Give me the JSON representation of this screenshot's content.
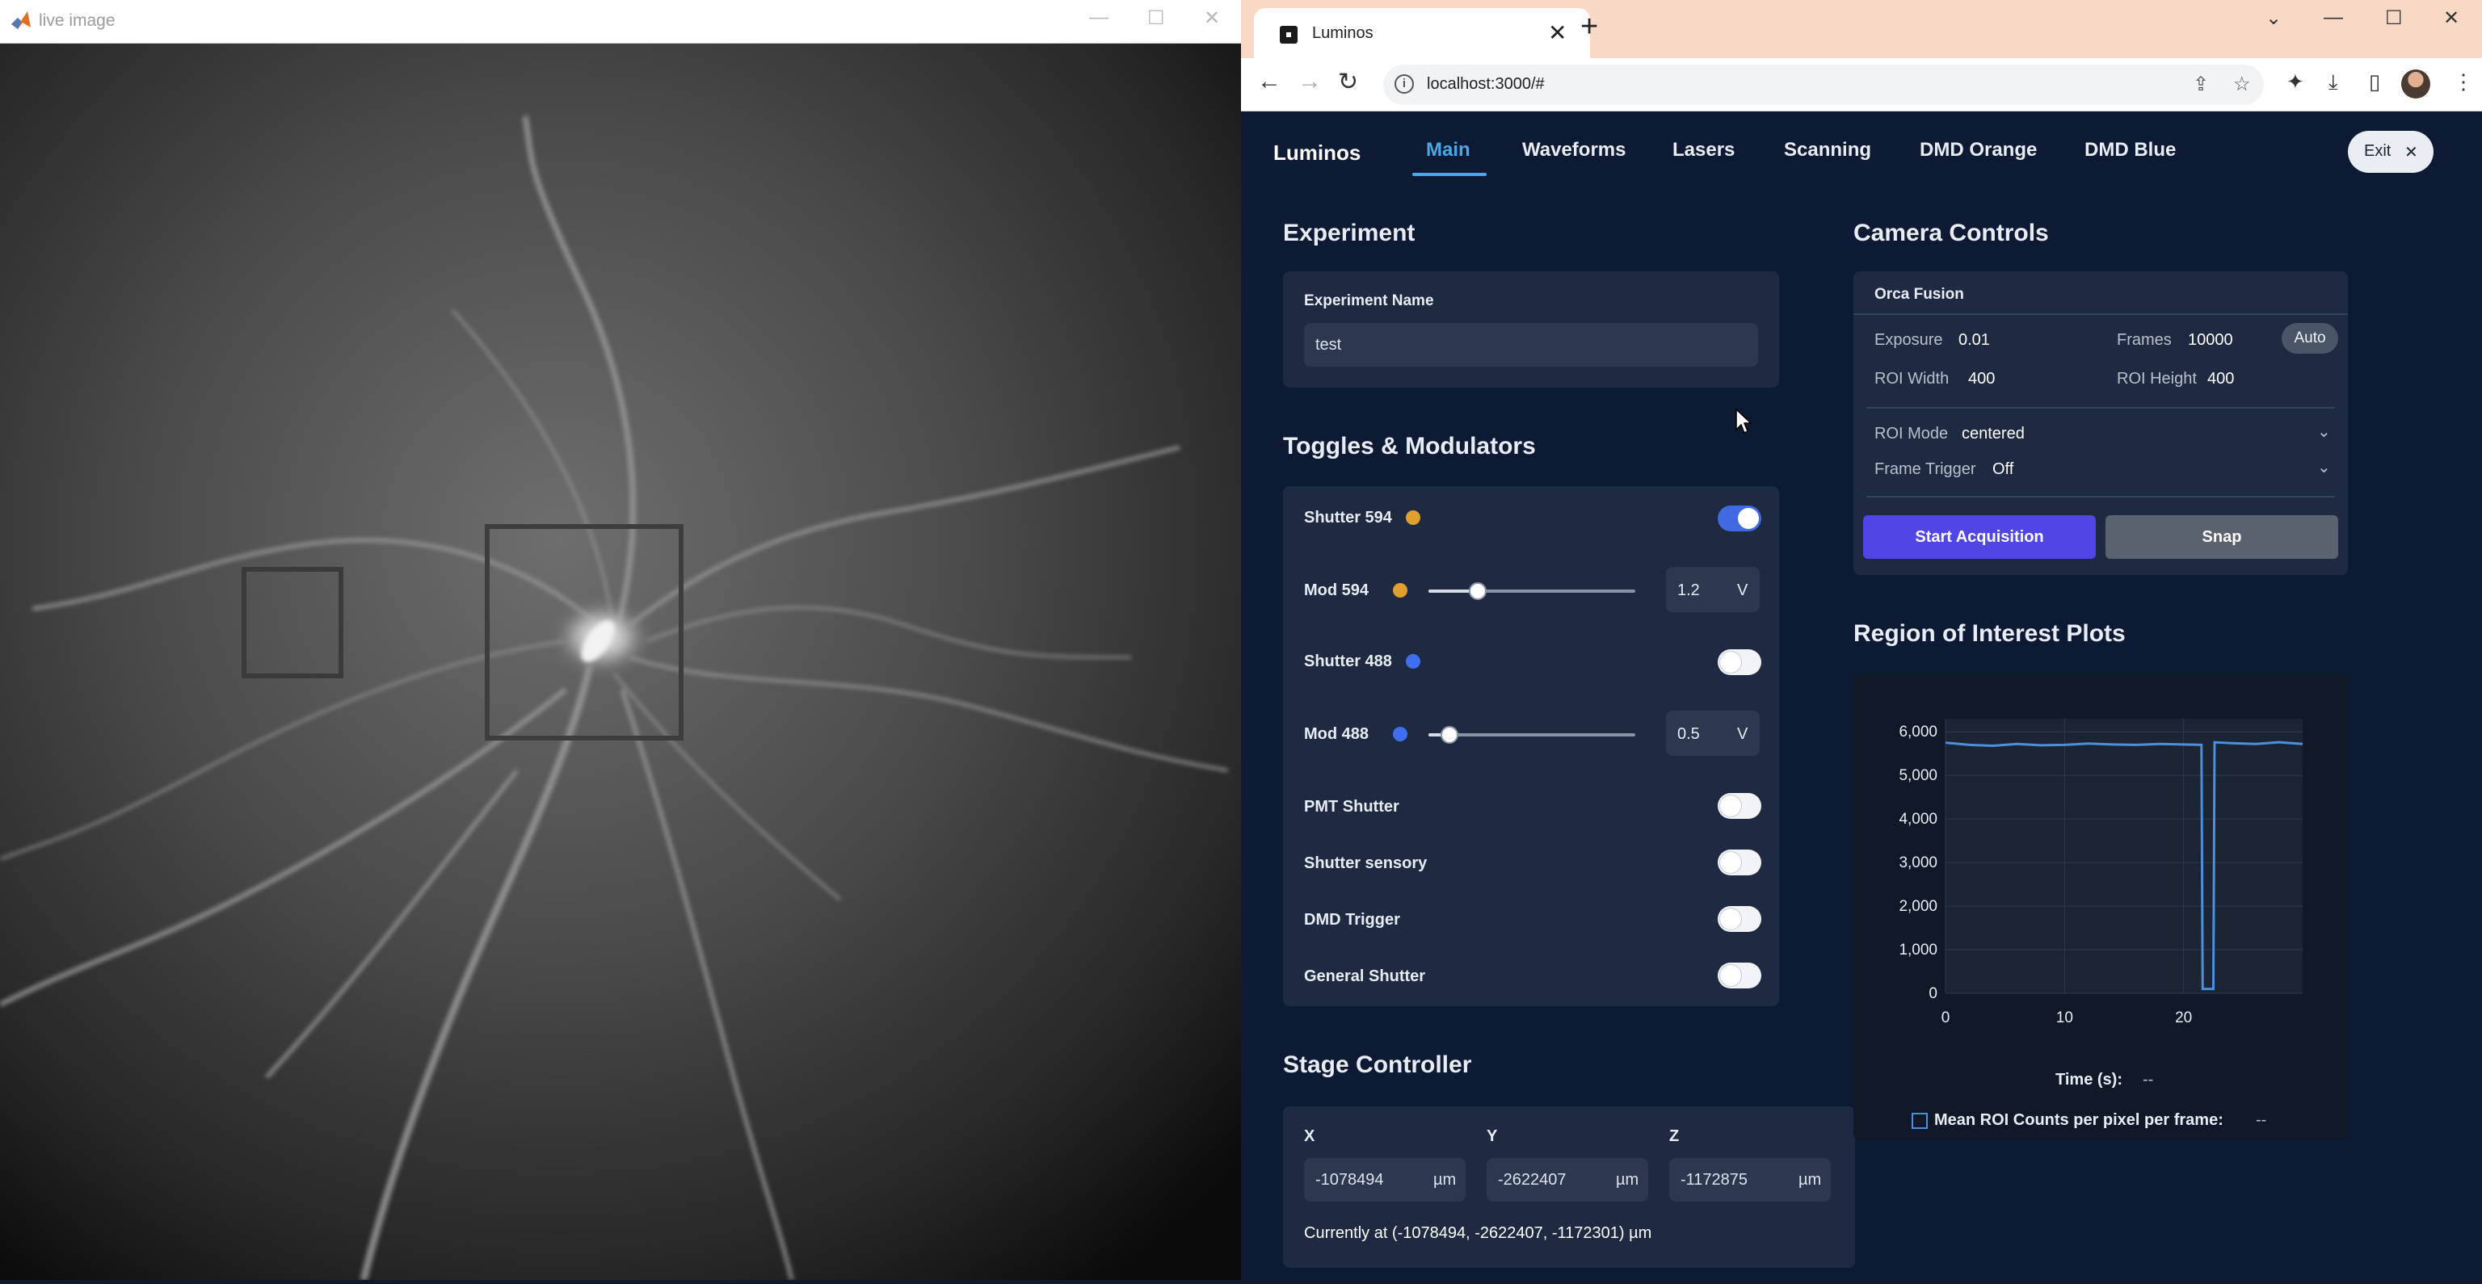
{
  "live_window": {
    "title": "live image",
    "controls": {
      "minimize": "—",
      "maximize": "☐",
      "close": "✕"
    }
  },
  "browser": {
    "tab_title": "Luminos",
    "tab_close": "✕",
    "new_tab": "+",
    "url": "localhost:3000/#",
    "window_controls": {
      "chevron": "⌄",
      "minimize": "—",
      "maximize": "☐",
      "close": "✕"
    }
  },
  "app": {
    "brand": "Luminos",
    "tabs": [
      {
        "label": "Main",
        "active": true
      },
      {
        "label": "Waveforms",
        "active": false
      },
      {
        "label": "Lasers",
        "active": false
      },
      {
        "label": "Scanning",
        "active": false
      },
      {
        "label": "DMD Orange",
        "active": false
      },
      {
        "label": "DMD Blue",
        "active": false
      }
    ],
    "exit_label": "Exit",
    "exit_icon": "✕"
  },
  "experiment": {
    "section_title": "Experiment",
    "name_label": "Experiment Name",
    "name_value": "test"
  },
  "toggles": {
    "section_title": "Toggles & Modulators",
    "shutter594": {
      "label": "Shutter 594",
      "on": true,
      "dot_color": "#e0a030"
    },
    "mod594": {
      "label": "Mod 594",
      "value": "1.2",
      "unit": "V",
      "fraction": 0.24,
      "dot_color": "#e0a030"
    },
    "shutter488": {
      "label": "Shutter 488",
      "on": false,
      "dot_color": "#3d6ff0"
    },
    "mod488": {
      "label": "Mod 488",
      "value": "0.5",
      "unit": "V",
      "fraction": 0.1,
      "dot_color": "#3d6ff0"
    },
    "pmt_shutter": {
      "label": "PMT Shutter",
      "on": false
    },
    "shutter_sensory": {
      "label": "Shutter sensory",
      "on": false
    },
    "dmd_trigger": {
      "label": "DMD Trigger",
      "on": false
    },
    "general_shutter": {
      "label": "General Shutter",
      "on": false
    }
  },
  "stage": {
    "section_title": "Stage Controller",
    "x_label": "X",
    "x_value": "-1078494",
    "y_label": "Y",
    "y_value": "-2622407",
    "z_label": "Z",
    "z_value": "-1172875",
    "unit": "µm",
    "current": "Currently at (-1078494, -2622407, -1172301) µm"
  },
  "camera": {
    "section_title": "Camera Controls",
    "camera_name": "Orca Fusion",
    "exposure_label": "Exposure",
    "exposure_value": "0.01",
    "frames_label": "Frames",
    "frames_value": "10000",
    "auto_label": "Auto",
    "roi_width_label": "ROI Width",
    "roi_width_value": "400",
    "roi_height_label": "ROI Height",
    "roi_height_value": "400",
    "roi_mode_label": "ROI Mode",
    "roi_mode_value": "centered",
    "frame_trigger_label": "Frame Trigger",
    "frame_trigger_value": "Off",
    "start_label": "Start Acquisition",
    "snap_label": "Snap",
    "primary_color": "#5046e5",
    "secondary_color": "#5a6270"
  },
  "roi_plots": {
    "section_title": "Region of Interest Plots",
    "time_label": "Time (s):",
    "time_value": "--",
    "legend_label": "Mean ROI Counts per pixel per frame:",
    "legend_value": "--"
  },
  "chart_data": {
    "type": "line",
    "x_ticks": [
      0,
      10,
      20
    ],
    "y_ticks": [
      "0",
      "1,000",
      "2,000",
      "3,000",
      "4,000",
      "5,000",
      "6,000"
    ],
    "xlim": [
      0,
      30
    ],
    "ylim": [
      0,
      6300
    ],
    "grid": true,
    "series": [
      {
        "color": "#4a8fe0",
        "x": [
          0,
          2,
          4,
          6,
          8,
          10,
          12,
          14,
          16,
          18,
          20,
          21.5,
          21.6,
          22.5,
          22.6,
          24,
          26,
          28,
          30
        ],
        "values": [
          5750,
          5700,
          5680,
          5720,
          5690,
          5700,
          5730,
          5710,
          5700,
          5720,
          5710,
          5700,
          100,
          100,
          5760,
          5740,
          5720,
          5760,
          5720
        ]
      }
    ]
  }
}
